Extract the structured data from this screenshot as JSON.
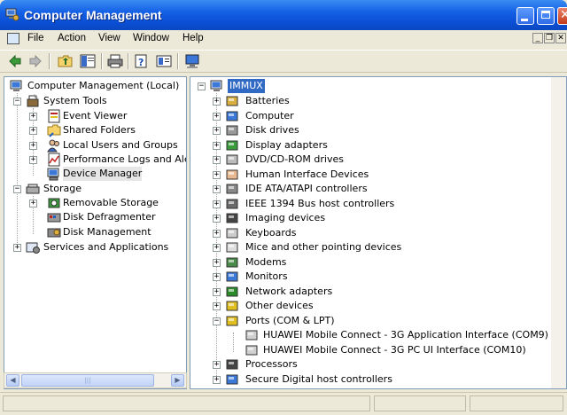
{
  "window": {
    "title": "Computer Management",
    "icon": "computer-management-icon",
    "colors": {
      "titlebar": "#0a4fd4",
      "selection": "#316ac5",
      "chrome": "#ece9d8"
    }
  },
  "menu": {
    "items": [
      "File",
      "Action",
      "View",
      "Window",
      "Help"
    ],
    "mdi_minimize": "_",
    "mdi_restore": "❐",
    "mdi_close": "✕"
  },
  "toolbar": {
    "icons": [
      "back-arrow-icon",
      "forward-arrow-icon",
      "up-folder-icon",
      "show-hide-tree-icon",
      "print-icon",
      "help-icon",
      "properties-icon",
      "scan-hardware-icon"
    ]
  },
  "left_tree": {
    "root": "Computer Management (Local)",
    "system_tools": {
      "label": "System Tools",
      "children": [
        "Event Viewer",
        "Shared Folders",
        "Local Users and Groups",
        "Performance Logs and Alerts",
        "Device Manager"
      ]
    },
    "storage": {
      "label": "Storage",
      "children": [
        "Removable Storage",
        "Disk Defragmenter",
        "Disk Management"
      ]
    },
    "services": "Services and Applications"
  },
  "device_tree": {
    "root": "IMMUX",
    "categories": [
      "Batteries",
      "Computer",
      "Disk drives",
      "Display adapters",
      "DVD/CD-ROM drives",
      "Human Interface Devices",
      "IDE ATA/ATAPI controllers",
      "IEEE 1394 Bus host controllers",
      "Imaging devices",
      "Keyboards",
      "Mice and other pointing devices",
      "Modems",
      "Monitors",
      "Network adapters",
      "Other devices",
      "Ports (COM & LPT)"
    ],
    "ports_children": [
      "HUAWEI Mobile Connect - 3G Application Interface (COM9)",
      "HUAWEI Mobile Connect - 3G PC UI Interface (COM10)"
    ],
    "after": [
      "Processors",
      "Secure Digital host controllers"
    ]
  },
  "scrollbar": {
    "thumb_grip": "|||"
  }
}
